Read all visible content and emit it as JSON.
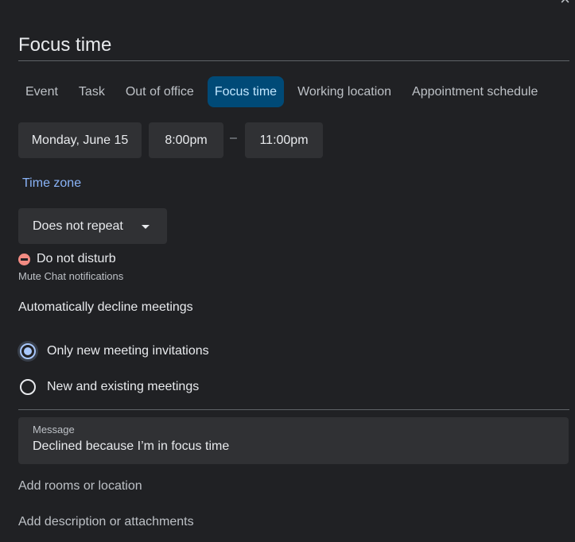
{
  "window": {
    "close_glyph": "×"
  },
  "title": {
    "value": "Focus time"
  },
  "tabs": [
    {
      "label": "Event",
      "active": false
    },
    {
      "label": "Task",
      "active": false
    },
    {
      "label": "Out of office",
      "active": false
    },
    {
      "label": "Focus time",
      "active": true
    },
    {
      "label": "Working location",
      "active": false
    },
    {
      "label": "Appointment schedule",
      "active": false
    }
  ],
  "datetime": {
    "date": "Monday, June 15",
    "start": "8:00pm",
    "separator": "–",
    "end": "11:00pm"
  },
  "timezone_link": "Time zone",
  "repeat": {
    "selected": "Does not repeat"
  },
  "dnd": {
    "label": "Do not disturb",
    "sublabel": "Mute Chat notifications"
  },
  "auto_decline": {
    "label": "Automatically decline meetings",
    "options": [
      {
        "label": "Only new meeting invitations",
        "checked": true
      },
      {
        "label": "New and existing meetings",
        "checked": false
      }
    ]
  },
  "message": {
    "label": "Message",
    "value": "Declined because I’m in focus time"
  },
  "links": {
    "rooms": "Add rooms or location",
    "description": "Add description or attachments"
  },
  "colors": {
    "background": "#202124",
    "active_tab_bg": "#004a77",
    "active_tab_text": "#c2e7ff",
    "link": "#8ab4f8",
    "dnd_icon": "#f28b82",
    "radio_checked": "#a8c7fa"
  },
  "icons": {
    "close": "close-icon",
    "dropdown": "chevron-down-icon",
    "dnd": "do-not-disturb-icon"
  }
}
